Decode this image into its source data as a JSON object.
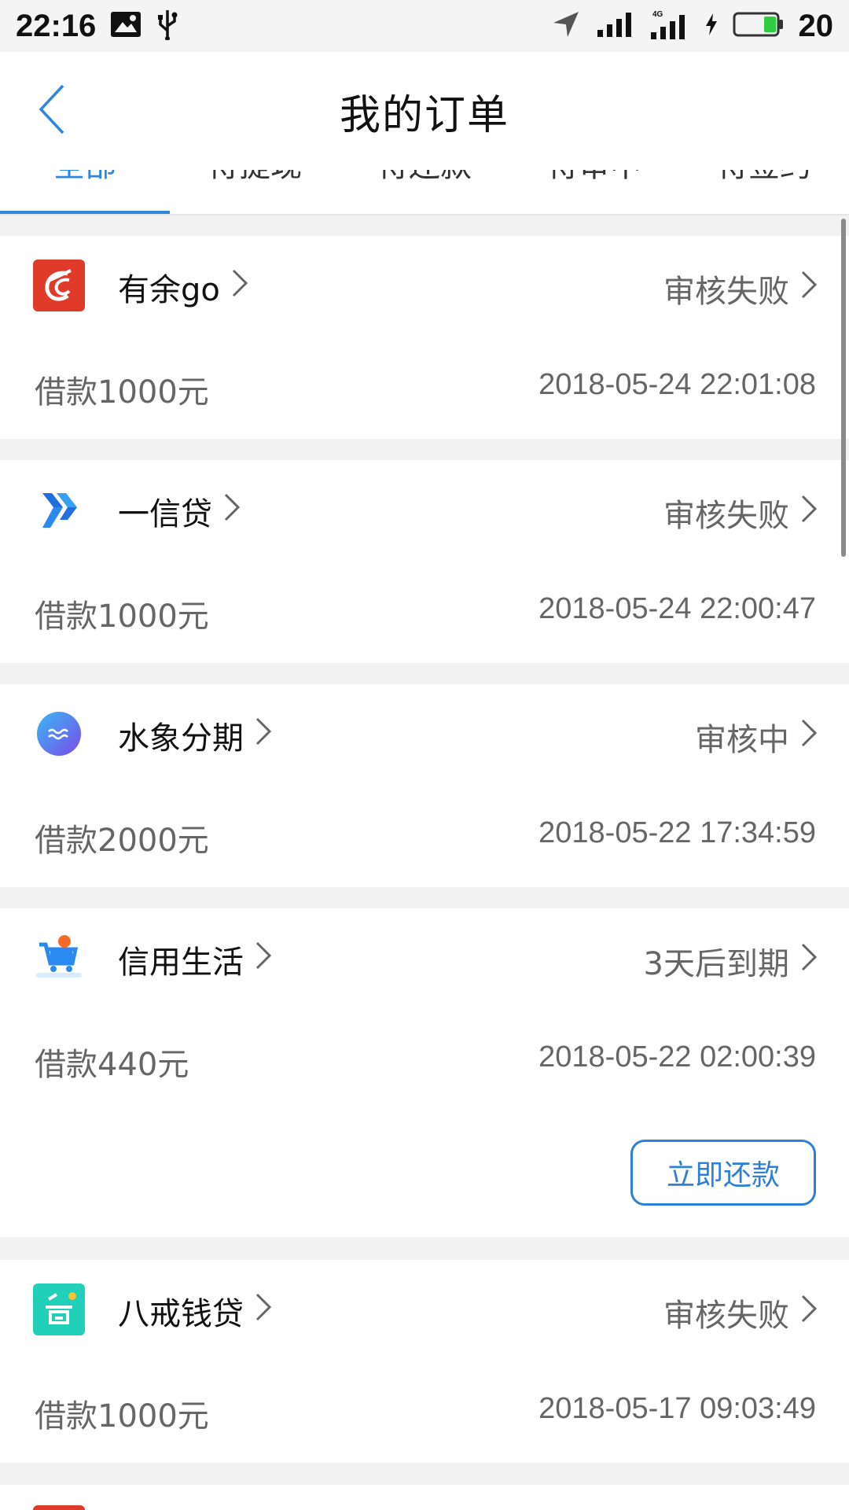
{
  "status_bar": {
    "time": "22:16",
    "battery_percent": "20",
    "icons": [
      "image-icon",
      "usb-icon",
      "location-arrow-icon",
      "signal-icon",
      "signal-4g-icon",
      "charging-icon",
      "battery-icon"
    ]
  },
  "header": {
    "title": "我的订单",
    "back_icon": "chevron-left-icon"
  },
  "tabs": [
    "全部",
    "待提现",
    "待还款",
    "待审中",
    "待签约"
  ],
  "accent_color": "#2f86dd",
  "orders": [
    {
      "name": "有余go",
      "status": "审核失败",
      "amount": "借款1000元",
      "time": "2018-05-24 22:01:08",
      "logo": "youyu-go-logo"
    },
    {
      "name": "一信贷",
      "status": "审核失败",
      "amount": "借款1000元",
      "time": "2018-05-24 22:00:47",
      "logo": "yixindai-logo"
    },
    {
      "name": "水象分期",
      "status": "审核中",
      "amount": "借款2000元",
      "time": "2018-05-22 17:34:59",
      "logo": "shuixiang-logo"
    },
    {
      "name": "信用生活",
      "status": "3天后到期",
      "amount": "借款440元",
      "time": "2018-05-22 02:00:39",
      "logo": "cart-logo",
      "action": "立即还款"
    },
    {
      "name": "八戒钱贷",
      "status": "审核失败",
      "amount": "借款1000元",
      "time": "2018-05-17 09:03:49",
      "logo": "bajie-logo"
    }
  ]
}
